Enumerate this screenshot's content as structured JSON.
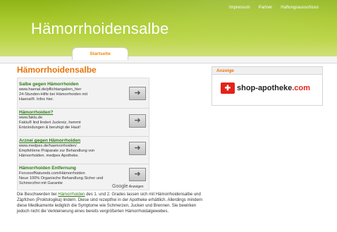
{
  "header": {
    "title": "Hämorrhoidensalbe",
    "nav": [
      "Impressum",
      "Partner",
      "Haftungsausschluss"
    ]
  },
  "tab": {
    "label": "Startseite"
  },
  "main": {
    "title": "Hämorrhoidensalbe",
    "ads": [
      {
        "title": "Salbe gegen Hämorrhoiden",
        "lines": [
          "www.haenal.de/pflichtangaben_hier",
          "24-Stunden-Hilfe bei Hämorrhoiden mit",
          "Haenal®. Infos hier."
        ]
      },
      {
        "title": "Hämorrhoiden?",
        "lines": [
          "www.faktu.de",
          "Faktu® lind lindert Juckreiz, hemmt",
          "Entzündungen & beruhigt die Haut!"
        ]
      },
      {
        "title": "Arznei gegen Hämorrhoiden",
        "lines": [
          "www.medpex.de/haemorrhoiden/",
          "Empfohlene Präparate zur Behandlung von",
          "Hämorrhoiden. medpex Apotheke."
        ]
      },
      {
        "title": "Hämorrhoiden Entfernung",
        "lines": [
          "ForcesofNatureds.com/Hämorrhoiden",
          "Neue 100% Organische Behandlung Sicher und",
          "Schmerzfrei mit Garantie"
        ]
      }
    ],
    "arrow_icon": "arrow-right-icon",
    "google_ads": {
      "logo": "Google",
      "label": "Anzeigen"
    },
    "body": {
      "before_link": "Die Beschwerden bei ",
      "link": "Hämorrhoiden",
      "after_link": " des 1. und 2. Grades lassen sich mit Hämorrhoidensalbe und Zäpfchen (Proktologika) lindern. Diese sind rezeptfrei in der Apotheke erhältlich. Allerdings mindern diese Medikamente lediglich die Symptome wie Schmerzen, Jucken und Brennen. Sie bewirken jedoch nicht die Verkleinerung eines bereits vergrößerten Hämorrhoidalgewebes."
    }
  },
  "sidebar": {
    "heading": "Anzeige",
    "logo_text": "shop-apotheke",
    "logo_tld": ".com",
    "logo_icon": "shop-apotheke-logo-icon"
  },
  "colors": {
    "header_green": "#a8c82c",
    "accent_orange": "#e8740a",
    "ad_title_green": "#2f7a16"
  }
}
